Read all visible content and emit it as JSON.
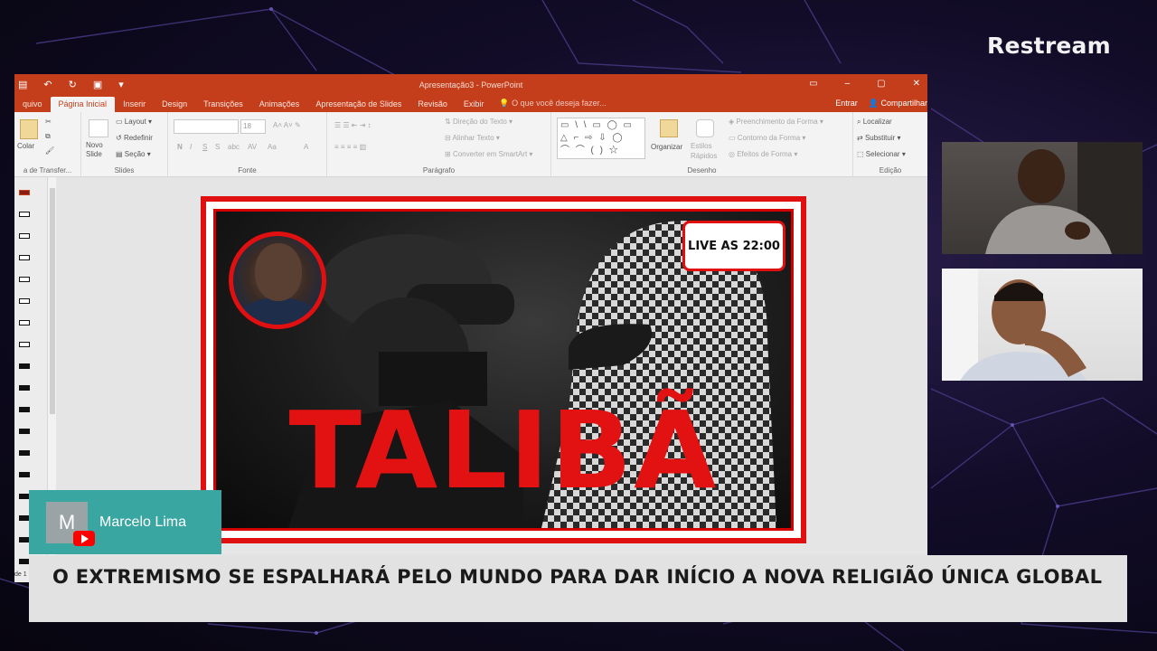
{
  "brand": "Restream",
  "powerpoint": {
    "doc_title": "Apresentação3 - PowerPoint",
    "tabs": [
      "quivo",
      "Página Inicial",
      "Inserir",
      "Design",
      "Transições",
      "Animações",
      "Apresentação de Slides",
      "Revisão",
      "Exibir"
    ],
    "active_tab": "Página Inicial",
    "tell_me": "O que você deseja fazer...",
    "right_actions": {
      "signin": "Entrar",
      "share": "Compartilhar"
    },
    "ribbon": {
      "clipboard": {
        "paste": "Colar",
        "label": "a de Transfer..."
      },
      "slides": {
        "new_slide": "Novo Slide",
        "layout": "Layout",
        "reset": "Redefinir",
        "section": "Seção",
        "label": "Slides"
      },
      "font": {
        "font_size": "18",
        "label": "Fonte"
      },
      "paragraph": {
        "text_direction": "Direção do Texto",
        "align_text": "Alinhar Texto",
        "smartart": "Converter em SmartArt",
        "label": "Parágrafo"
      },
      "drawing": {
        "arrange": "Organizar",
        "quick_styles": "Estilos Rápidos",
        "fill": "Preenchimento da Forma",
        "outline": "Contorno da Forma",
        "effects": "Efeitos de Forma",
        "label": "Desenho"
      },
      "editing": {
        "find": "Localizar",
        "replace": "Substituir",
        "select": "Selecionar",
        "label": "Edição"
      }
    },
    "status_left": "de 1"
  },
  "slide": {
    "badge": "LIVE AS 22:00",
    "title": "TALIBÃ"
  },
  "participant": {
    "initial": "M",
    "name": "Marcelo Lima"
  },
  "headline": "O EXTREMISMO SE ESPALHARÁ PELO MUNDO PARA DAR INÍCIO A NOVA RELIGIÃO ÚNICA GLOBAL",
  "colors": {
    "powerpoint_accent": "#c43e1c",
    "slide_red": "#e01010",
    "nametag_teal": "#3aa6a2",
    "youtube_red": "#ff0000"
  },
  "icons": [
    "youtube-icon",
    "share-person-icon",
    "search-icon",
    "undo-icon",
    "save-icon"
  ]
}
